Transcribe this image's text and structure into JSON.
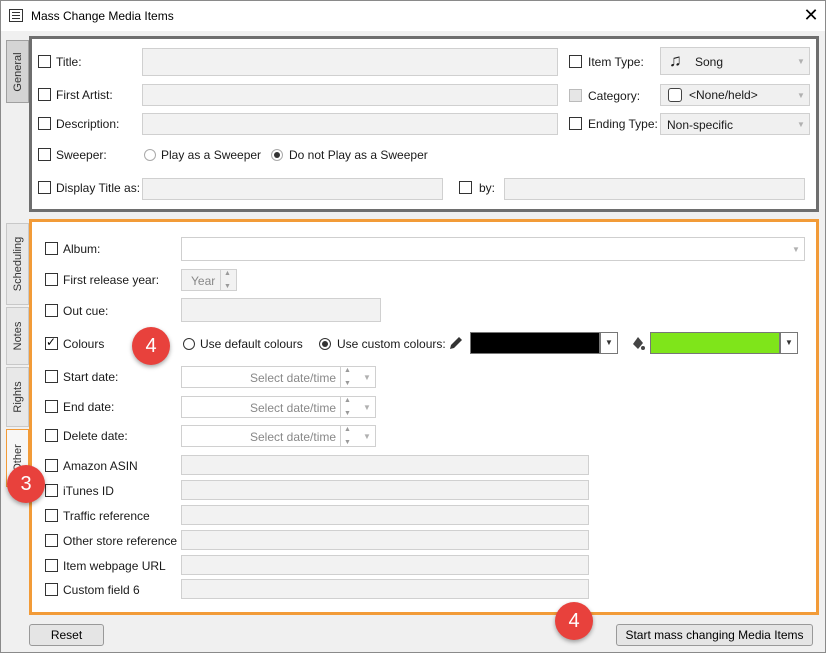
{
  "window": {
    "title": "Mass Change Media Items"
  },
  "tabs": [
    "General",
    "Scheduling",
    "Notes",
    "Rights",
    "Other"
  ],
  "general": {
    "title_label": "Title:",
    "first_artist_label": "First Artist:",
    "description_label": "Description:",
    "sweeper_label": "Sweeper:",
    "sweeper_opt1": "Play as a Sweeper",
    "sweeper_opt2": "Do not Play as a Sweeper",
    "display_title_label": "Display Title as:",
    "by_label": "by:",
    "item_type_label": "Item Type:",
    "item_type_value": "Song",
    "category_label": "Category:",
    "category_value": "<None/held>",
    "ending_type_label": "Ending Type:",
    "ending_type_value": "Non-specific"
  },
  "other": {
    "album_label": "Album:",
    "first_release_label": "First release year:",
    "year_placeholder": "Year",
    "out_cue_label": "Out cue:",
    "colours_label": "Colours",
    "use_default": "Use default colours",
    "use_custom": "Use custom colours:",
    "text_colour": "#000000",
    "bg_colour": "#7fe51a",
    "start_date_label": "Start date:",
    "end_date_label": "End date:",
    "delete_date_label": "Delete date:",
    "date_placeholder": "Select date/time",
    "amazon_label": "Amazon ASIN",
    "itunes_label": "iTunes ID",
    "traffic_label": "Traffic reference",
    "other_store_label": "Other store reference",
    "webpage_label": "Item webpage URL",
    "custom6_label": "Custom field 6"
  },
  "badges": {
    "colours": "4",
    "other_tab": "3",
    "start_button": "4"
  },
  "buttons": {
    "reset": "Reset",
    "start": "Start mass changing Media Items"
  },
  "colors": {
    "accent_other": "#f29b38",
    "badge": "#e8413c"
  }
}
